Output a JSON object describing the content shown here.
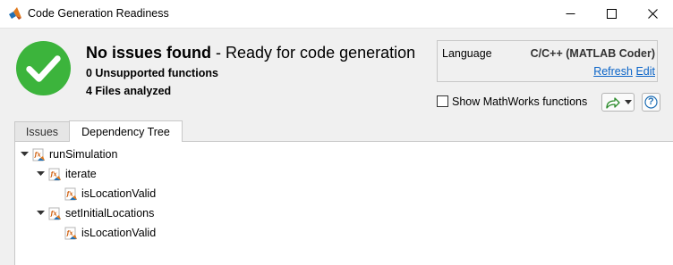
{
  "window": {
    "title": "Code Generation Readiness"
  },
  "summary": {
    "status_bold": "No issues found",
    "separator": " - ",
    "status_detail": "Ready for code generation",
    "unsupported": "0 Unsupported functions",
    "files": "4 Files analyzed",
    "status_color": "#3cb43c"
  },
  "language": {
    "label": "Language",
    "value": "C/C++ (MATLAB Coder)",
    "refresh": "Refresh",
    "edit": "Edit"
  },
  "options": {
    "show_mathworks_label": "Show MathWorks functions",
    "show_mathworks_checked": false,
    "help_label": "?"
  },
  "tabs": {
    "issues": "Issues",
    "dependency_tree": "Dependency Tree",
    "active": "dependency_tree"
  },
  "tree": [
    {
      "label": "runSimulation",
      "expanded": true
    },
    {
      "label": "iterate",
      "expanded": true
    },
    {
      "label": "isLocationValid",
      "expanded": null
    },
    {
      "label": "setInitialLocations",
      "expanded": true
    },
    {
      "label": "isLocationValid",
      "expanded": null
    }
  ]
}
